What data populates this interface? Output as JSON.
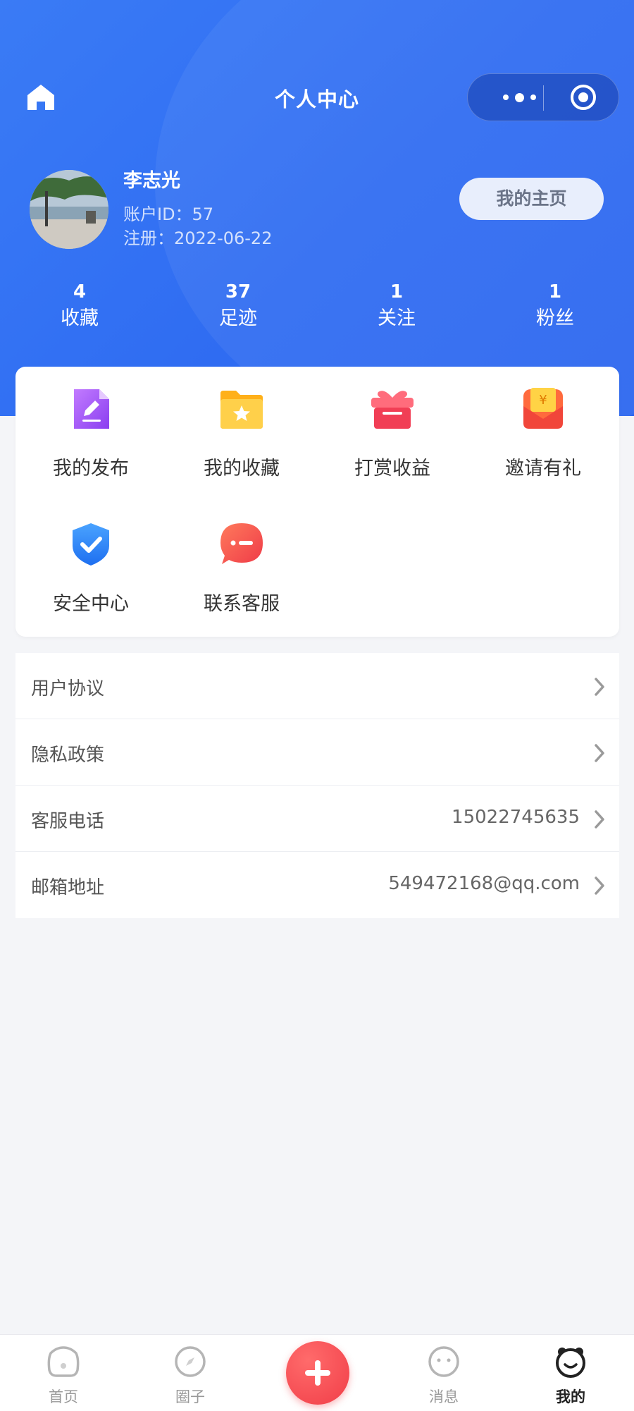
{
  "header": {
    "title": "个人中心",
    "home_icon": "home-icon",
    "more_icon": "more-dots-icon",
    "target_icon": "target-icon"
  },
  "profile": {
    "name": "李志光",
    "account_id": "账户ID：57",
    "register_date": "注册：2022-06-22",
    "homepage_button": "我的主页"
  },
  "stats": [
    {
      "value": "4",
      "label": "收藏"
    },
    {
      "value": "37",
      "label": "足迹"
    },
    {
      "value": "1",
      "label": "关注"
    },
    {
      "value": "1",
      "label": "粉丝"
    }
  ],
  "grid": [
    {
      "label": "我的发布",
      "icon": "edit-document-icon",
      "color": "#a35cf0"
    },
    {
      "label": "我的收藏",
      "icon": "star-folder-icon",
      "color": "#ffc531"
    },
    {
      "label": "打赏收益",
      "icon": "gift-icon",
      "color": "#f3465c"
    },
    {
      "label": "邀请有礼",
      "icon": "red-envelope-icon",
      "color": "#f55a3c"
    },
    {
      "label": "安全中心",
      "icon": "shield-check-icon",
      "color": "#2f86f6"
    },
    {
      "label": "联系客服",
      "icon": "chat-bubble-icon",
      "color": "#f2504a"
    }
  ],
  "list": [
    {
      "label": "用户协议",
      "value": ""
    },
    {
      "label": "隐私政策",
      "value": ""
    },
    {
      "label": "客服电话",
      "value": "15022745635"
    },
    {
      "label": "邮箱地址",
      "value": "549472168@qq.com"
    }
  ],
  "tabbar": [
    {
      "label": "首页",
      "icon": "home-tab-icon"
    },
    {
      "label": "圈子",
      "icon": "compass-icon"
    },
    {
      "label": "",
      "icon": "plus-icon"
    },
    {
      "label": "消息",
      "icon": "message-face-icon"
    },
    {
      "label": "我的",
      "icon": "profile-face-icon",
      "active": true
    }
  ],
  "colors": {
    "header_blue": "#2f6cf2",
    "publish_red": "#f13e48",
    "page_bg": "#f4f5f8"
  }
}
